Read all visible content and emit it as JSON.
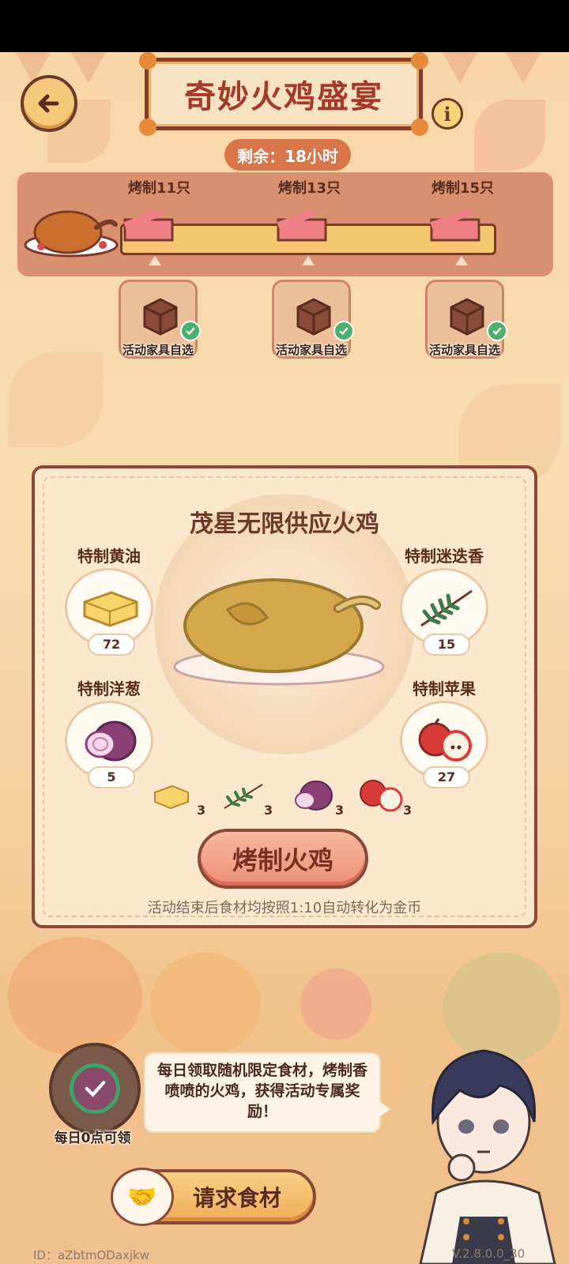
{
  "header": {
    "title": "奇妙火鸡盛宴",
    "timer_label": "剩余：18小时"
  },
  "milestones": [
    {
      "label": "烤制11只",
      "reward_label": "活动家具自选",
      "claimed": true
    },
    {
      "label": "烤制13只",
      "reward_label": "活动家具自选",
      "claimed": true
    },
    {
      "label": "烤制15只",
      "reward_label": "活动家具自选",
      "claimed": true
    }
  ],
  "card": {
    "title": "茂星无限供应火鸡",
    "ingredients": [
      {
        "name": "特制黄油",
        "count": "72",
        "icon": "butter-icon"
      },
      {
        "name": "特制迷迭香",
        "count": "15",
        "icon": "rosemary-icon"
      },
      {
        "name": "特制洋葱",
        "count": "5",
        "icon": "onion-icon"
      },
      {
        "name": "特制苹果",
        "count": "27",
        "icon": "apple-icon"
      }
    ],
    "recipe": [
      {
        "icon": "butter-icon",
        "qty": "3"
      },
      {
        "icon": "rosemary-icon",
        "qty": "3"
      },
      {
        "icon": "onion-icon",
        "qty": "3"
      },
      {
        "icon": "apple-icon",
        "qty": "3"
      }
    ],
    "cook_button": "烤制火鸡",
    "note": "活动结束后食材均按照1:10自动转化为金币"
  },
  "daily": {
    "label": "每日0点可领",
    "speech": "每日领取随机限定食材，烤制香喷喷的火鸡，获得活动专属奖励！",
    "request_button": "请求食材"
  },
  "footer": {
    "id": "ID：aZbtmODaxjkw",
    "version": "V.2.8.0.0_30"
  },
  "colors": {
    "accent": "#a63a2a",
    "panel": "#d9906e",
    "button": "#ee8f75"
  }
}
